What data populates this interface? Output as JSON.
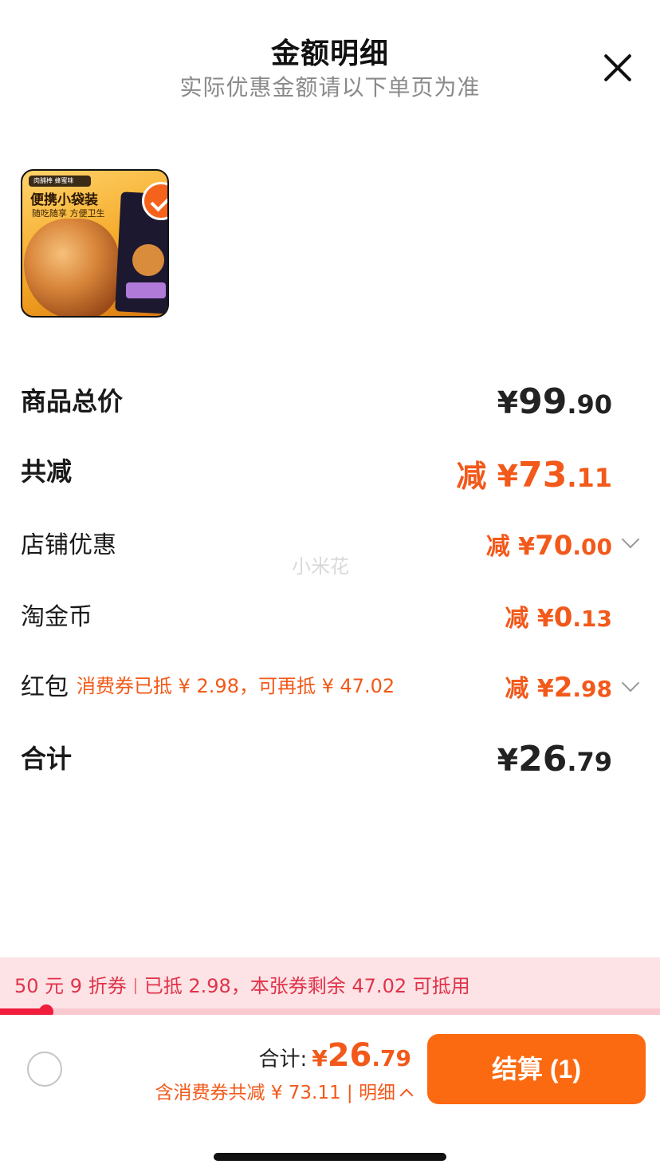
{
  "header": {
    "title": "金额明细",
    "subtitle": "实际优惠金额请以下单页为准"
  },
  "product": {
    "tag": "肉脯棒 蜂蜜味",
    "title": "便携小袋装",
    "subtitle": "随吃随享 方便卫生"
  },
  "rows": {
    "total_price": {
      "label": "商品总价",
      "currency": "¥",
      "int": "99",
      "dec": ".90"
    },
    "total_discount": {
      "label": "共减",
      "prefix": "减 ¥",
      "int": "73",
      "dec": ".11"
    },
    "shop_discount": {
      "label": "店铺优惠",
      "prefix": "减 ¥",
      "int": "70",
      "dec": ".00"
    },
    "taojinbi": {
      "label": "淘金币",
      "prefix": "减 ¥",
      "int": "0",
      "dec": ".13"
    },
    "red_packet": {
      "label": "红包",
      "note": "消费券已抵 ¥ 2.98，可再抵 ¥ 47.02",
      "prefix": "减 ¥",
      "int": "2",
      "dec": ".98"
    },
    "subtotal": {
      "label": "合计",
      "currency": "¥",
      "int": "26",
      "dec": ".79"
    }
  },
  "watermark": "小米花",
  "coupon_banner": {
    "coupon_name": "50 元 9 折券",
    "detail": "已抵 2.98，本张券剩余 47.02 可抵用",
    "progress_fraction": 0.07
  },
  "bottom_bar": {
    "total_label": "合计:",
    "total_currency": "¥",
    "total_int": "26",
    "total_dec": ".79",
    "discount_text": "含消费券共减 ¥ 73.11 | 明细",
    "checkout_label": "结算 (1)"
  },
  "colors": {
    "accent_orange": "#f2591a",
    "checkout_button": "#fb6a10",
    "banner_bg": "#fde3e6",
    "banner_text": "#e0334a"
  }
}
